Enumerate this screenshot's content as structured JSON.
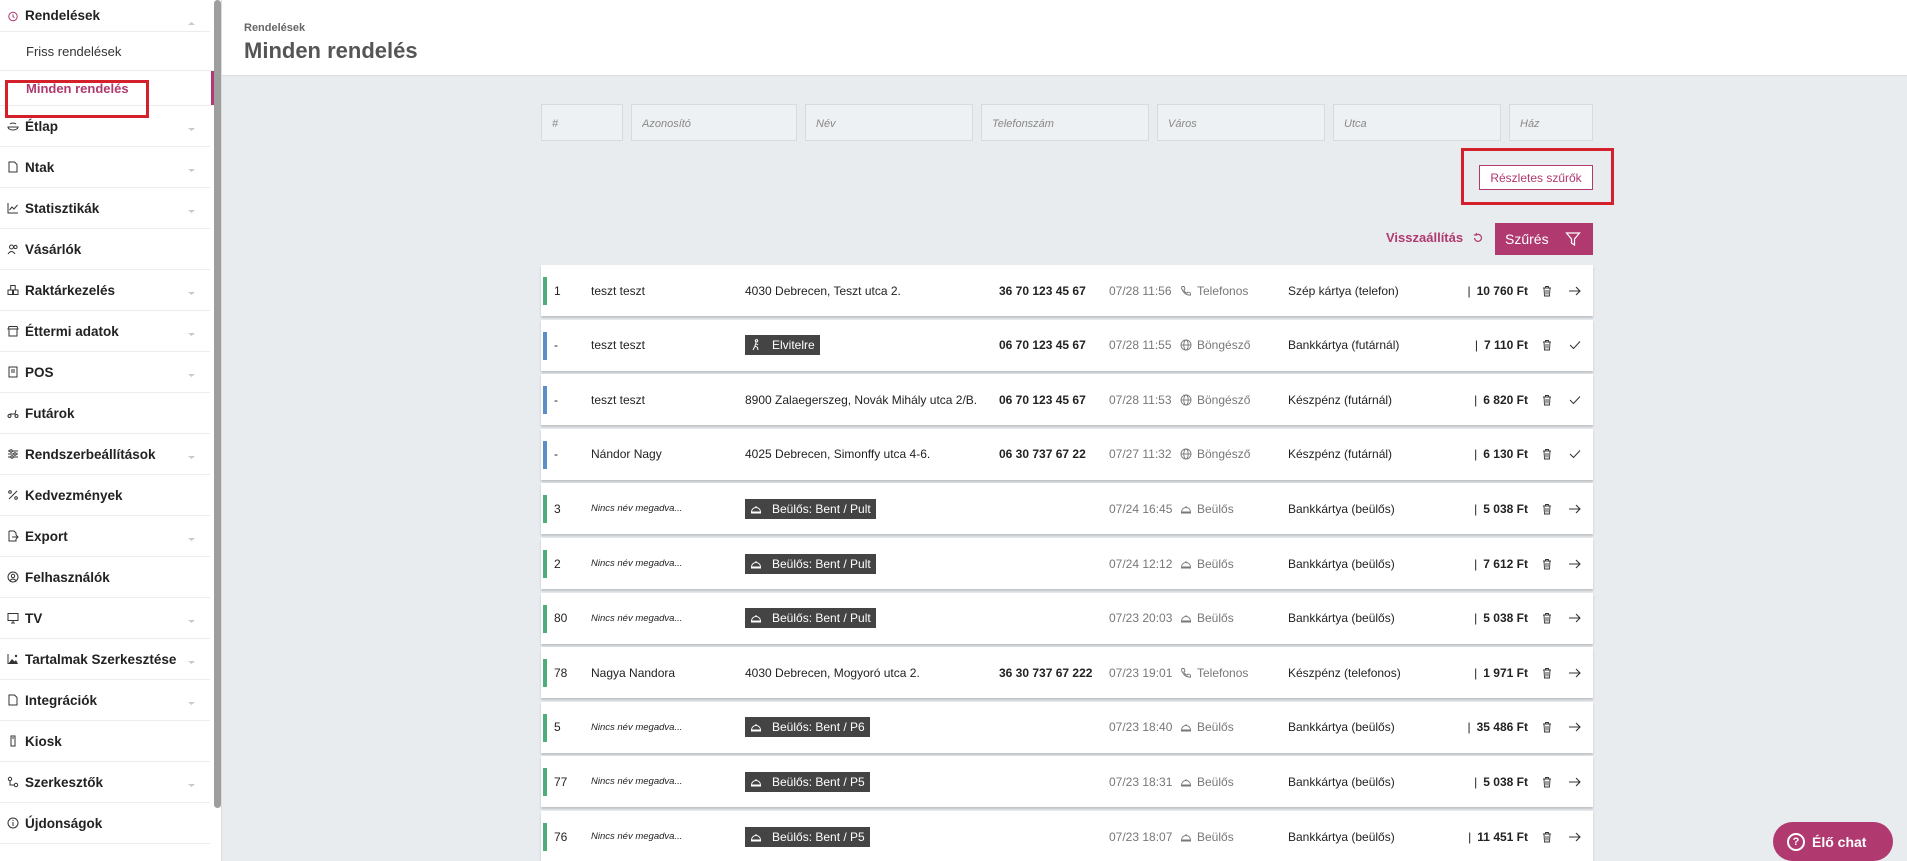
{
  "sidebar": {
    "items": [
      {
        "label": "Rendelések",
        "icon": "alarm-clock-icon",
        "expanded": true
      },
      {
        "label": "Étlap",
        "icon": "menu-icon"
      },
      {
        "label": "Ntak",
        "icon": "document-icon"
      },
      {
        "label": "Statisztikák",
        "icon": "chart-icon"
      },
      {
        "label": "Vásárlók",
        "icon": "users-icon"
      },
      {
        "label": "Raktárkezelés",
        "icon": "boxes-icon"
      },
      {
        "label": "Éttermi adatok",
        "icon": "store-icon"
      },
      {
        "label": "POS",
        "icon": "pos-icon"
      },
      {
        "label": "Futárok",
        "icon": "scooter-icon"
      },
      {
        "label": "Rendszerbeállítások",
        "icon": "sliders-icon"
      },
      {
        "label": "Kedvezmények",
        "icon": "percent-icon"
      },
      {
        "label": "Export",
        "icon": "export-icon"
      },
      {
        "label": "Felhasználók",
        "icon": "user-circle-icon"
      },
      {
        "label": "TV",
        "icon": "monitor-icon"
      },
      {
        "label": "Tartalmak Szerkesztése",
        "icon": "image-icon"
      },
      {
        "label": "Integrációk",
        "icon": "file-icon"
      },
      {
        "label": "Kiosk",
        "icon": "kiosk-icon"
      },
      {
        "label": "Szerkesztők",
        "icon": "nodes-icon"
      },
      {
        "label": "Újdonságok",
        "icon": "info-icon"
      }
    ],
    "subitems": [
      {
        "label": "Friss rendelések"
      },
      {
        "label": "Minden rendelés",
        "active": true
      }
    ]
  },
  "header": {
    "breadcrumb": "Rendelések",
    "title": "Minden rendelés"
  },
  "filters": [
    {
      "placeholder": "#"
    },
    {
      "placeholder": "Azonosító"
    },
    {
      "placeholder": "Név"
    },
    {
      "placeholder": "Telefonszám"
    },
    {
      "placeholder": "Város"
    },
    {
      "placeholder": "Utca"
    },
    {
      "placeholder": "Ház"
    }
  ],
  "actions": {
    "detail_filters": "Részletes szűrők",
    "reset": "Visszaállítás",
    "filter": "Szűrés"
  },
  "colors": {
    "accent": "#b0396f",
    "bar_green": "#4caf7a",
    "bar_blue": "#5b8fc7",
    "highlight": "#d3202a"
  },
  "orders": [
    {
      "num": "1",
      "name": "teszt teszt",
      "address": "4030 Debrecen, Teszt utca 2.",
      "phone": "36 70 123 45 67",
      "time": "07/28 11:56",
      "source": "Telefonos",
      "source_icon": "phone-icon",
      "payment": "Szép kártya (telefon)",
      "price": "10 760 Ft",
      "action": "arrow-right-icon",
      "bar": "green"
    },
    {
      "num": "-",
      "name": "teszt teszt",
      "tag": "Elvitelre",
      "tag_icon": "walking-icon",
      "phone": "06 70 123 45 67",
      "time": "07/28 11:55",
      "source": "Böngésző",
      "source_icon": "globe-icon",
      "payment": "Bankkártya (futárnál)",
      "price": "7 110 Ft",
      "action": "check-icon",
      "bar": "blue"
    },
    {
      "num": "-",
      "name": "teszt teszt",
      "address": "8900 Zalaegerszeg, Novák Mihály utca 2/B.",
      "phone": "06 70 123 45 67",
      "time": "07/28 11:53",
      "source": "Böngésző",
      "source_icon": "globe-icon",
      "payment": "Készpénz (futárnál)",
      "price": "6 820 Ft",
      "action": "check-icon",
      "bar": "blue"
    },
    {
      "num": "-",
      "name": "Nándor Nagy",
      "address": "4025 Debrecen, Simonffy utca 4-6.",
      "phone": "06 30 737 67 22",
      "time": "07/27 11:32",
      "source": "Böngésző",
      "source_icon": "globe-icon",
      "payment": "Készpénz (futárnál)",
      "price": "6 130 Ft",
      "action": "check-icon",
      "bar": "blue"
    },
    {
      "num": "3",
      "name": "Nincs név megadva...",
      "italic": true,
      "tag": "Beülős: Bent / Pult",
      "tag_icon": "cloche-icon",
      "phone": "",
      "time": "07/24 16:45",
      "source": "Beülős",
      "source_icon": "cloche-icon",
      "payment": "Bankkártya (beülős)",
      "price": "5 038 Ft",
      "action": "arrow-right-icon",
      "bar": "green"
    },
    {
      "num": "2",
      "name": "Nincs név megadva...",
      "italic": true,
      "tag": "Beülős: Bent / Pult",
      "tag_icon": "cloche-icon",
      "phone": "",
      "time": "07/24 12:12",
      "source": "Beülős",
      "source_icon": "cloche-icon",
      "payment": "Bankkártya (beülős)",
      "price": "7 612 Ft",
      "action": "arrow-right-icon",
      "bar": "green"
    },
    {
      "num": "80",
      "name": "Nincs név megadva...",
      "italic": true,
      "tag": "Beülős: Bent / Pult",
      "tag_icon": "cloche-icon",
      "phone": "",
      "time": "07/23 20:03",
      "source": "Beülős",
      "source_icon": "cloche-icon",
      "payment": "Bankkártya (beülős)",
      "price": "5 038 Ft",
      "action": "arrow-right-icon",
      "bar": "green"
    },
    {
      "num": "78",
      "name": "Nagya Nandora",
      "address": "4030 Debrecen, Mogyoró utca 2.",
      "phone": "36 30 737 67 222",
      "time": "07/23 19:01",
      "source": "Telefonos",
      "source_icon": "phone-icon",
      "payment": "Készpénz (telefonos)",
      "price": "1 971 Ft",
      "action": "arrow-right-icon",
      "bar": "green"
    },
    {
      "num": "5",
      "name": "Nincs név megadva...",
      "italic": true,
      "tag": "Beülős: Bent / P6",
      "tag_icon": "cloche-icon",
      "phone": "",
      "time": "07/23 18:40",
      "source": "Beülős",
      "source_icon": "cloche-icon",
      "payment": "Bankkártya (beülős)",
      "price": "35 486 Ft",
      "action": "arrow-right-icon",
      "bar": "green"
    },
    {
      "num": "77",
      "name": "Nincs név megadva...",
      "italic": true,
      "tag": "Beülős: Bent / P5",
      "tag_icon": "cloche-icon",
      "phone": "",
      "time": "07/23 18:31",
      "source": "Beülős",
      "source_icon": "cloche-icon",
      "payment": "Bankkártya (beülős)",
      "price": "5 038 Ft",
      "action": "arrow-right-icon",
      "bar": "green"
    },
    {
      "num": "76",
      "name": "Nincs név megadva...",
      "italic": true,
      "tag": "Beülős: Bent / P5",
      "tag_icon": "cloche-icon",
      "phone": "",
      "time": "07/23 18:07",
      "source": "Beülős",
      "source_icon": "cloche-icon",
      "payment": "Bankkártya (beülős)",
      "price": "11 451 Ft",
      "action": "arrow-right-icon",
      "bar": "green"
    }
  ],
  "chat": {
    "label": "Élő chat"
  }
}
